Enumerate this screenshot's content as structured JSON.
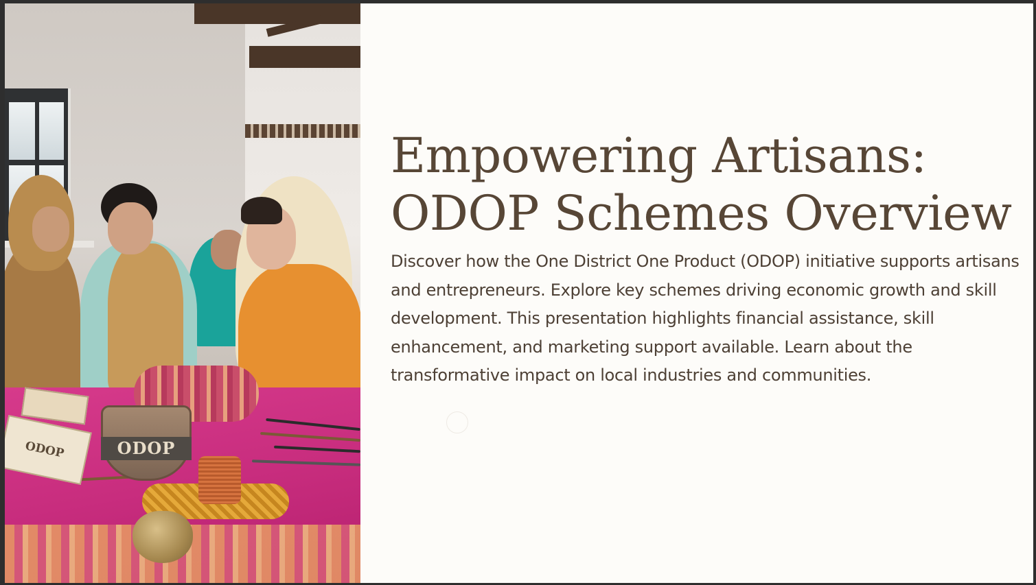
{
  "slide": {
    "title_line1": "Empowering Artisans:",
    "title_line2": "ODOP Schemes Overview",
    "body": "Discover how the One District One Product (ODOP) initiative supports artisans and entrepreneurs. Explore key schemes driving economic growth and skill development. This presentation highlights financial assistance, skill enhancement, and marketing support available. Learn about the transformative impact on local industries and communities."
  },
  "photo": {
    "bowl_text": "ODOP",
    "tag_text": "ODOP"
  },
  "colors": {
    "title": "#574636",
    "body": "#4d4035",
    "slide_background": "#fdfcf9",
    "frame": "#2e2e2e",
    "table_cloth": "#c82d7e"
  }
}
